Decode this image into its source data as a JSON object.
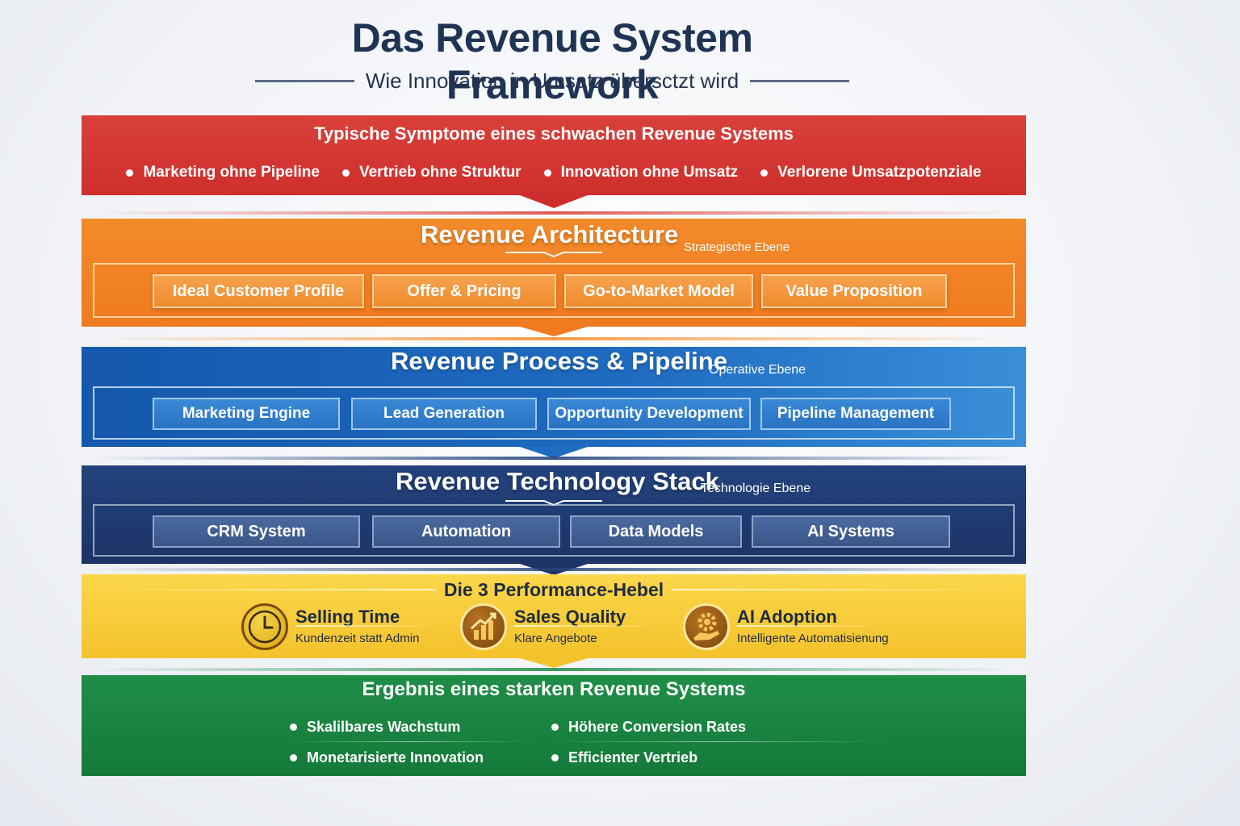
{
  "header": {
    "title": "Das Revenue System Framework",
    "subtitle": "Wie Innovation in Umsatz übersctzt wird"
  },
  "symptoms": {
    "title": "Typische Symptome eines schwachen Revenue Systems",
    "items": [
      "Marketing ohne Pipeline",
      "Vertrieb ohne Struktur",
      "Innovation ohne Umsatz",
      "Verlorene Umsatzpotenziale"
    ]
  },
  "architecture": {
    "title": "Revenue Architecture",
    "tag": "Strategische Ebene",
    "items": [
      "Ideal Customer Profile",
      "Offer & Pricing",
      "Go-to-Market Model",
      "Value Proposition"
    ]
  },
  "process": {
    "title": "Revenue Process & Pipeline",
    "tag": "Operative Ebene",
    "items": [
      "Marketing Engine",
      "Lead Generation",
      "Opportunity Development",
      "Pipeline Management"
    ]
  },
  "technology": {
    "title": "Revenue Technology Stack",
    "tag": "Technologie Ebene",
    "items": [
      "CRM System",
      "Automation",
      "Data Models",
      "AI Systems"
    ]
  },
  "performance": {
    "title": "Die 3 Performance-Hebel",
    "levers": [
      {
        "name": "Selling Time",
        "desc": "Kundenzeit statt Admin",
        "icon": "clock-icon"
      },
      {
        "name": "Sales Quality",
        "desc": "Klare Angebote",
        "icon": "chart-growth-icon"
      },
      {
        "name": "AI Adoption",
        "desc": "Intelligente Automatisienung",
        "icon": "gear-hand-icon"
      }
    ]
  },
  "result": {
    "title": "Ergebnis eines starken Revenue Systems",
    "items": [
      "Skalilbares Wachstum",
      "Höhere Conversion Rates",
      "Monetarisierte Innovation",
      "Efficienter Vertrieb"
    ]
  },
  "colors": {
    "red": "#cf2f2c",
    "orange": "#f07b1f",
    "blue": "#1f6cc2",
    "navy": "#1c3467",
    "yellow": "#f4c22c",
    "green": "#15793a",
    "title_text": "#1f3354"
  }
}
